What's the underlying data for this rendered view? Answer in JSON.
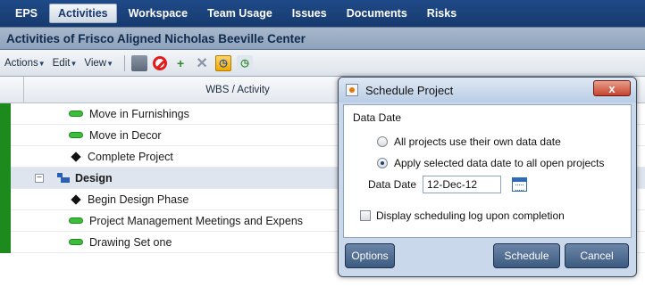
{
  "nav": {
    "items": [
      "EPS",
      "Activities",
      "Workspace",
      "Team Usage",
      "Issues",
      "Documents",
      "Risks"
    ],
    "active": "Activities"
  },
  "page": {
    "title": "Activities of Frisco Aligned Nicholas Beeville Center"
  },
  "toolbar": {
    "actions_label": "Actions",
    "edit_label": "Edit",
    "view_label": "View"
  },
  "grid": {
    "column_header": "WBS / Activity",
    "rows": [
      {
        "type": "activity",
        "label": "Move in Furnishings"
      },
      {
        "type": "activity",
        "label": "Move in Decor"
      },
      {
        "type": "milestone",
        "label": "Complete Project"
      },
      {
        "type": "wbs",
        "label": "Design"
      },
      {
        "type": "milestone",
        "label": "Begin Design Phase"
      },
      {
        "type": "activity",
        "label": "Project Management Meetings and Expens"
      },
      {
        "type": "activity",
        "label": "Drawing Set one"
      }
    ]
  },
  "dialog": {
    "title": "Schedule Project",
    "close_label": "x",
    "section_label": "Data Date",
    "radio_own": "All projects use their own data date",
    "radio_apply": "Apply selected data date to all open projects",
    "data_date_label": "Data Date",
    "data_date_value": "12-Dec-12",
    "log_checkbox": "Display scheduling log upon completion",
    "options_button": "Options",
    "schedule_button": "Schedule",
    "cancel_button": "Cancel"
  }
}
